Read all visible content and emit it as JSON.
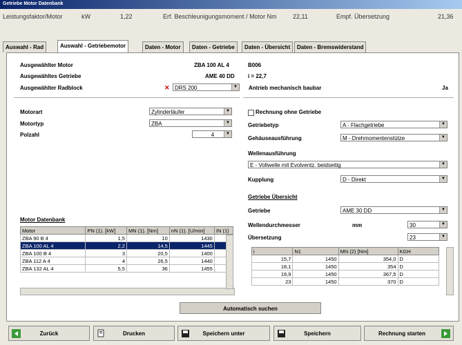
{
  "window": {
    "title": "Getriebe Motor Datenbank"
  },
  "infobar": {
    "power_label": "Leistungsfaktor/Motor",
    "power_unit": "kW",
    "power_value": "1,22",
    "torque_label": "Erf. Beschleunigungsmoment / Motor Nm",
    "torque_value": "22,11",
    "ratio_label": "Empf. Übersetzung",
    "ratio_value": "21,36"
  },
  "tabs": [
    {
      "label": "Auswahl - Rad"
    },
    {
      "label": "Auswahl - Getriebemotor"
    },
    {
      "label": "Daten - Motor"
    },
    {
      "label": "Daten - Getriebe"
    },
    {
      "label": "Daten - Übersicht"
    },
    {
      "label": "Daten - Bremswiderstand"
    }
  ],
  "selection": {
    "motor_label": "Ausgewählter Motor",
    "motor_value": "ZBA 100 AL 4",
    "motor_code": "B006",
    "gear_label": "Ausgewähltes Getriebe",
    "gear_value": "AME 40 DD",
    "gear_ratio": "i = 22,7",
    "wheel_label": "Ausgewählter Radblock",
    "wheel_value": "DRS 200",
    "drive_label": "Antrieb mechanisch baubar",
    "drive_value": "Ja"
  },
  "motor": {
    "type_label": "Motorart",
    "type_value": "Zylinderläufer",
    "motortype_label": "Motortyp",
    "motortype_value": "ZBA",
    "poles_label": "Polzahl",
    "poles_value": "4"
  },
  "gear": {
    "no_gear_label": "Rechnung ohne Getriebe",
    "geartype_label": "Getriebetyp",
    "geartype_value": "A - Flachgetriebe",
    "housing_label": "Gehäuseausführung",
    "housing_value": "M - Drehmomentenstütze",
    "shaft_label": "Wellenausführung",
    "shaft_value": "E - Vollwelle mit Evolventz. beidseitig",
    "coupling_label": "Kupplung",
    "coupling_value": "D - Direkt",
    "selection_link": "Getriebe Übersicht",
    "gearbox_label": "Getriebe",
    "gearbox_value": "AME 30 DD",
    "shaftdia_label": "Wellendurchmesser",
    "shaftdia_unit": "mm",
    "shaftdia_value": "30",
    "ratio_label": "Übersetzung",
    "ratio_value": "23"
  },
  "motor_table": {
    "title": "Motor Datenbank",
    "headers": [
      "Motor",
      "PN (1). [kW]",
      "MN (1). [Nm]",
      "nN (1). [U/min]",
      "IN (1)"
    ],
    "rows": [
      [
        "ZBA 90 B 4",
        "1,5",
        "10",
        "1430",
        ""
      ],
      [
        "ZBA 100 AL 4",
        "2,2",
        "14,5",
        "1445",
        ""
      ],
      [
        "ZBA 100 B 4",
        "3",
        "20,5",
        "1400",
        ""
      ],
      [
        "ZBA 112 A 4",
        "4",
        "26,5",
        "1440",
        ""
      ],
      [
        "ZBA 132 AL 4",
        "5,5",
        "36",
        "1455",
        ""
      ]
    ]
  },
  "gear_table": {
    "headers": [
      "i",
      "N1",
      "MN (2) [Nm]",
      "KGH"
    ],
    "rows": [
      [
        "15,7",
        "1450",
        "354,0",
        "D"
      ],
      [
        "18,1",
        "1450",
        "354",
        "D"
      ],
      [
        "19,9",
        "1450",
        "367,5",
        "D"
      ],
      [
        "23",
        "1450",
        "370",
        "D"
      ]
    ]
  },
  "auto_button": "Automatisch suchen",
  "footer": {
    "back": "Zurück",
    "print": "Drucken",
    "save_as": "Speichern unter",
    "save": "Speichern",
    "finish": "Rechnung starten"
  }
}
